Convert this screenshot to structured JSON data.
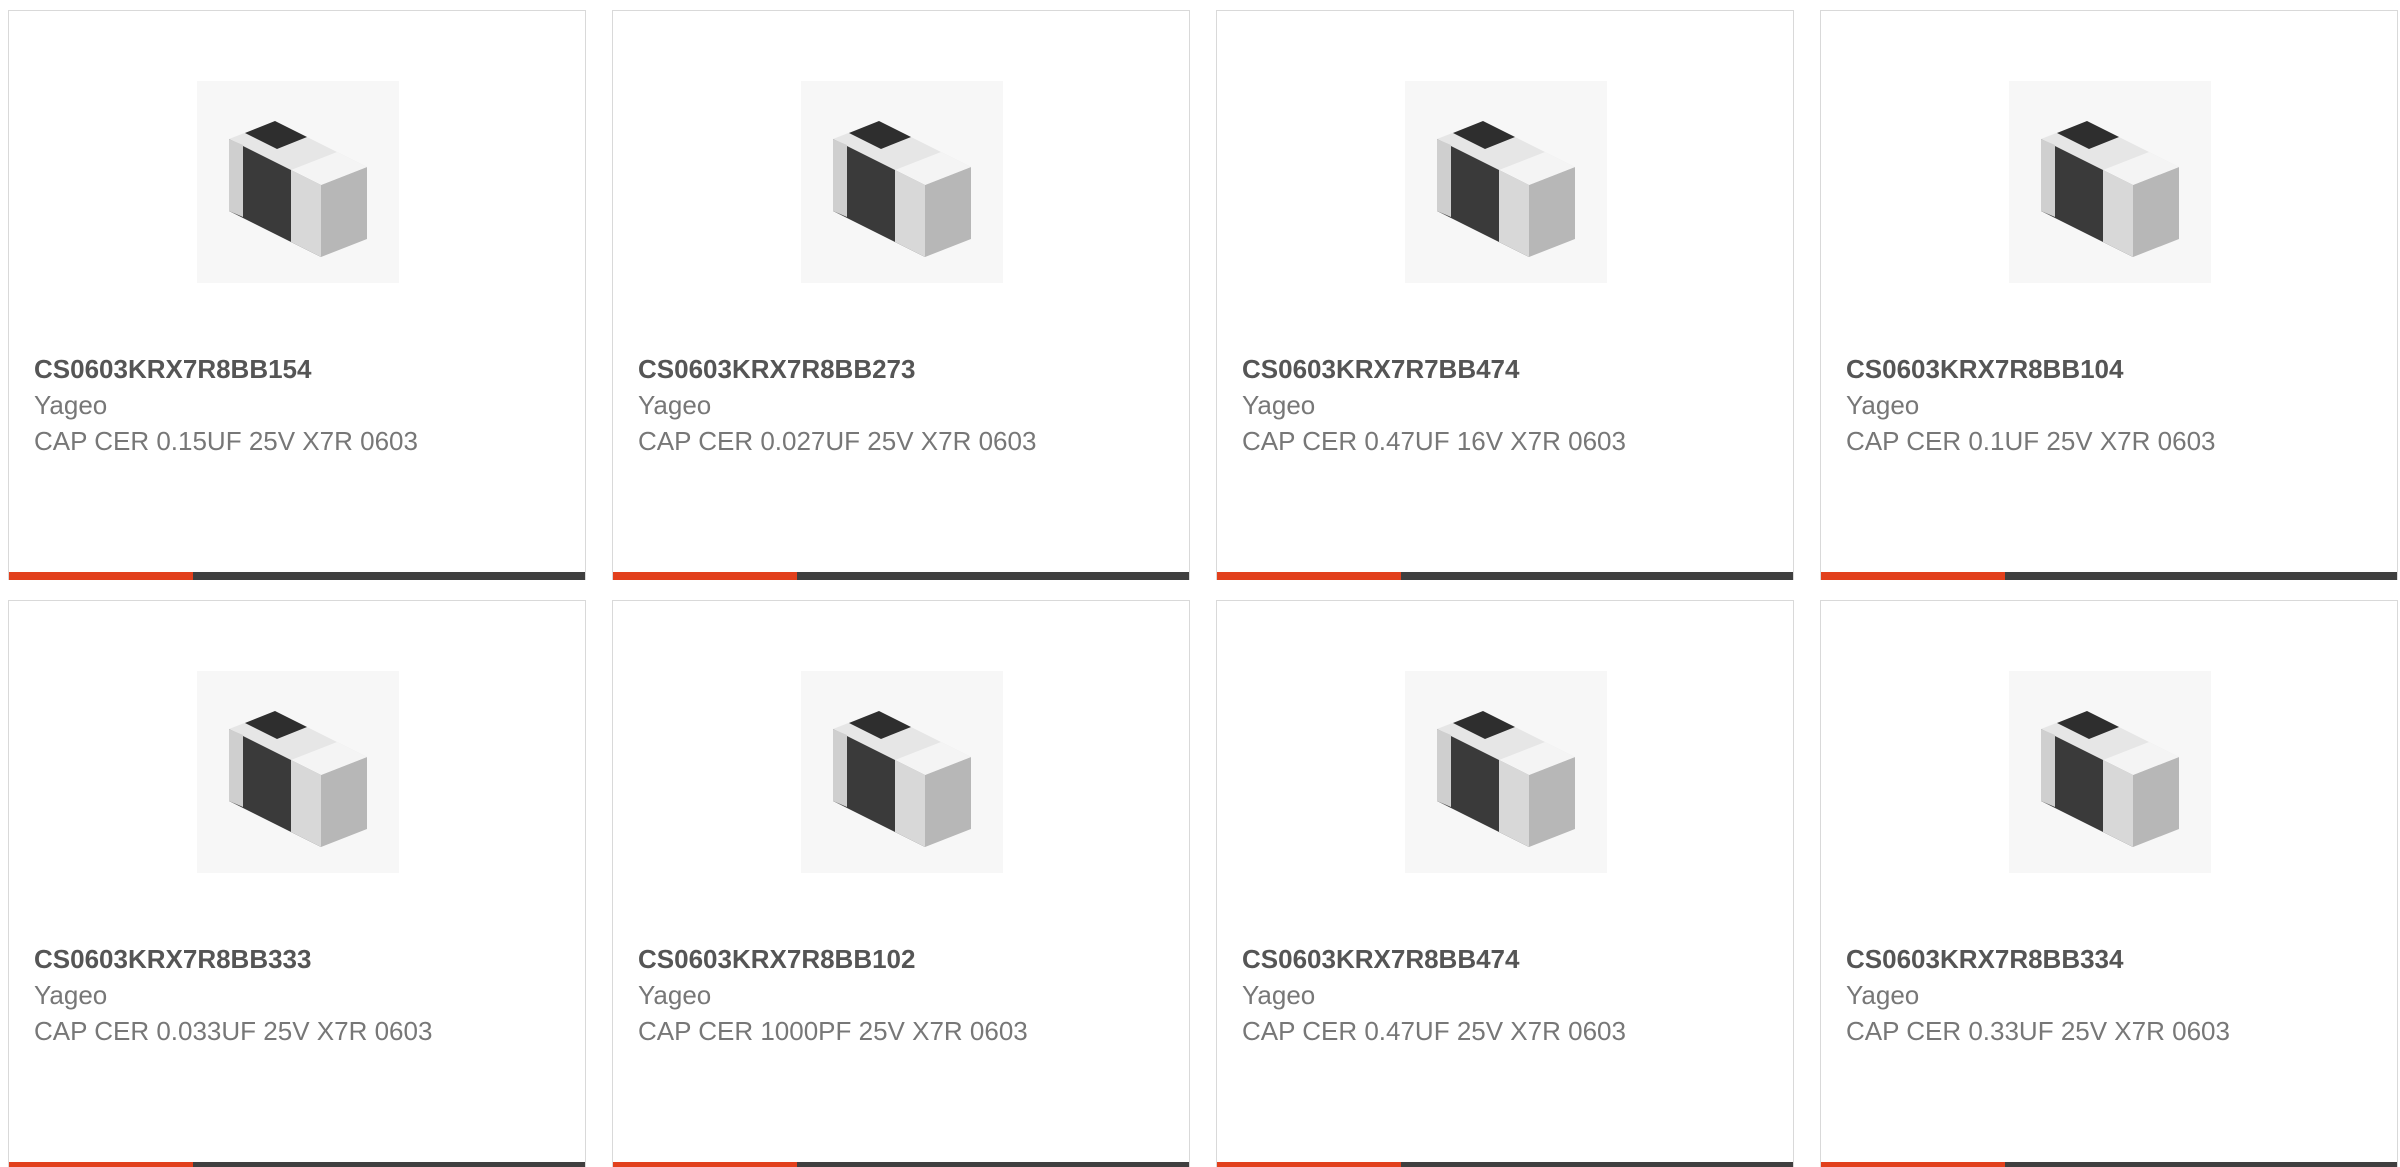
{
  "colors": {
    "accent": "#e2401c",
    "bar": "#3f3f3f",
    "part_number": "#555555",
    "meta_text": "#777777",
    "card_border": "#d9d9d9"
  },
  "products": [
    {
      "part": "CS0603KRX7R8BB154",
      "manufacturer": "Yageo",
      "description": "CAP CER 0.15UF 25V X7R 0603",
      "image_icon": "smd-capacitor-icon"
    },
    {
      "part": "CS0603KRX7R8BB273",
      "manufacturer": "Yageo",
      "description": "CAP CER 0.027UF 25V X7R 0603",
      "image_icon": "smd-capacitor-icon"
    },
    {
      "part": "CS0603KRX7R7BB474",
      "manufacturer": "Yageo",
      "description": "CAP CER 0.47UF 16V X7R 0603",
      "image_icon": "smd-capacitor-icon"
    },
    {
      "part": "CS0603KRX7R8BB104",
      "manufacturer": "Yageo",
      "description": "CAP CER 0.1UF 25V X7R 0603",
      "image_icon": "smd-capacitor-icon"
    },
    {
      "part": "CS0603KRX7R8BB333",
      "manufacturer": "Yageo",
      "description": "CAP CER 0.033UF 25V X7R 0603",
      "image_icon": "smd-capacitor-icon"
    },
    {
      "part": "CS0603KRX7R8BB102",
      "manufacturer": "Yageo",
      "description": "CAP CER 1000PF 25V X7R 0603",
      "image_icon": "smd-capacitor-icon"
    },
    {
      "part": "CS0603KRX7R8BB474",
      "manufacturer": "Yageo",
      "description": "CAP CER 0.47UF 25V X7R 0603",
      "image_icon": "smd-capacitor-icon"
    },
    {
      "part": "CS0603KRX7R8BB334",
      "manufacturer": "Yageo",
      "description": "CAP CER 0.33UF 25V X7R 0603",
      "image_icon": "smd-capacitor-icon"
    }
  ]
}
